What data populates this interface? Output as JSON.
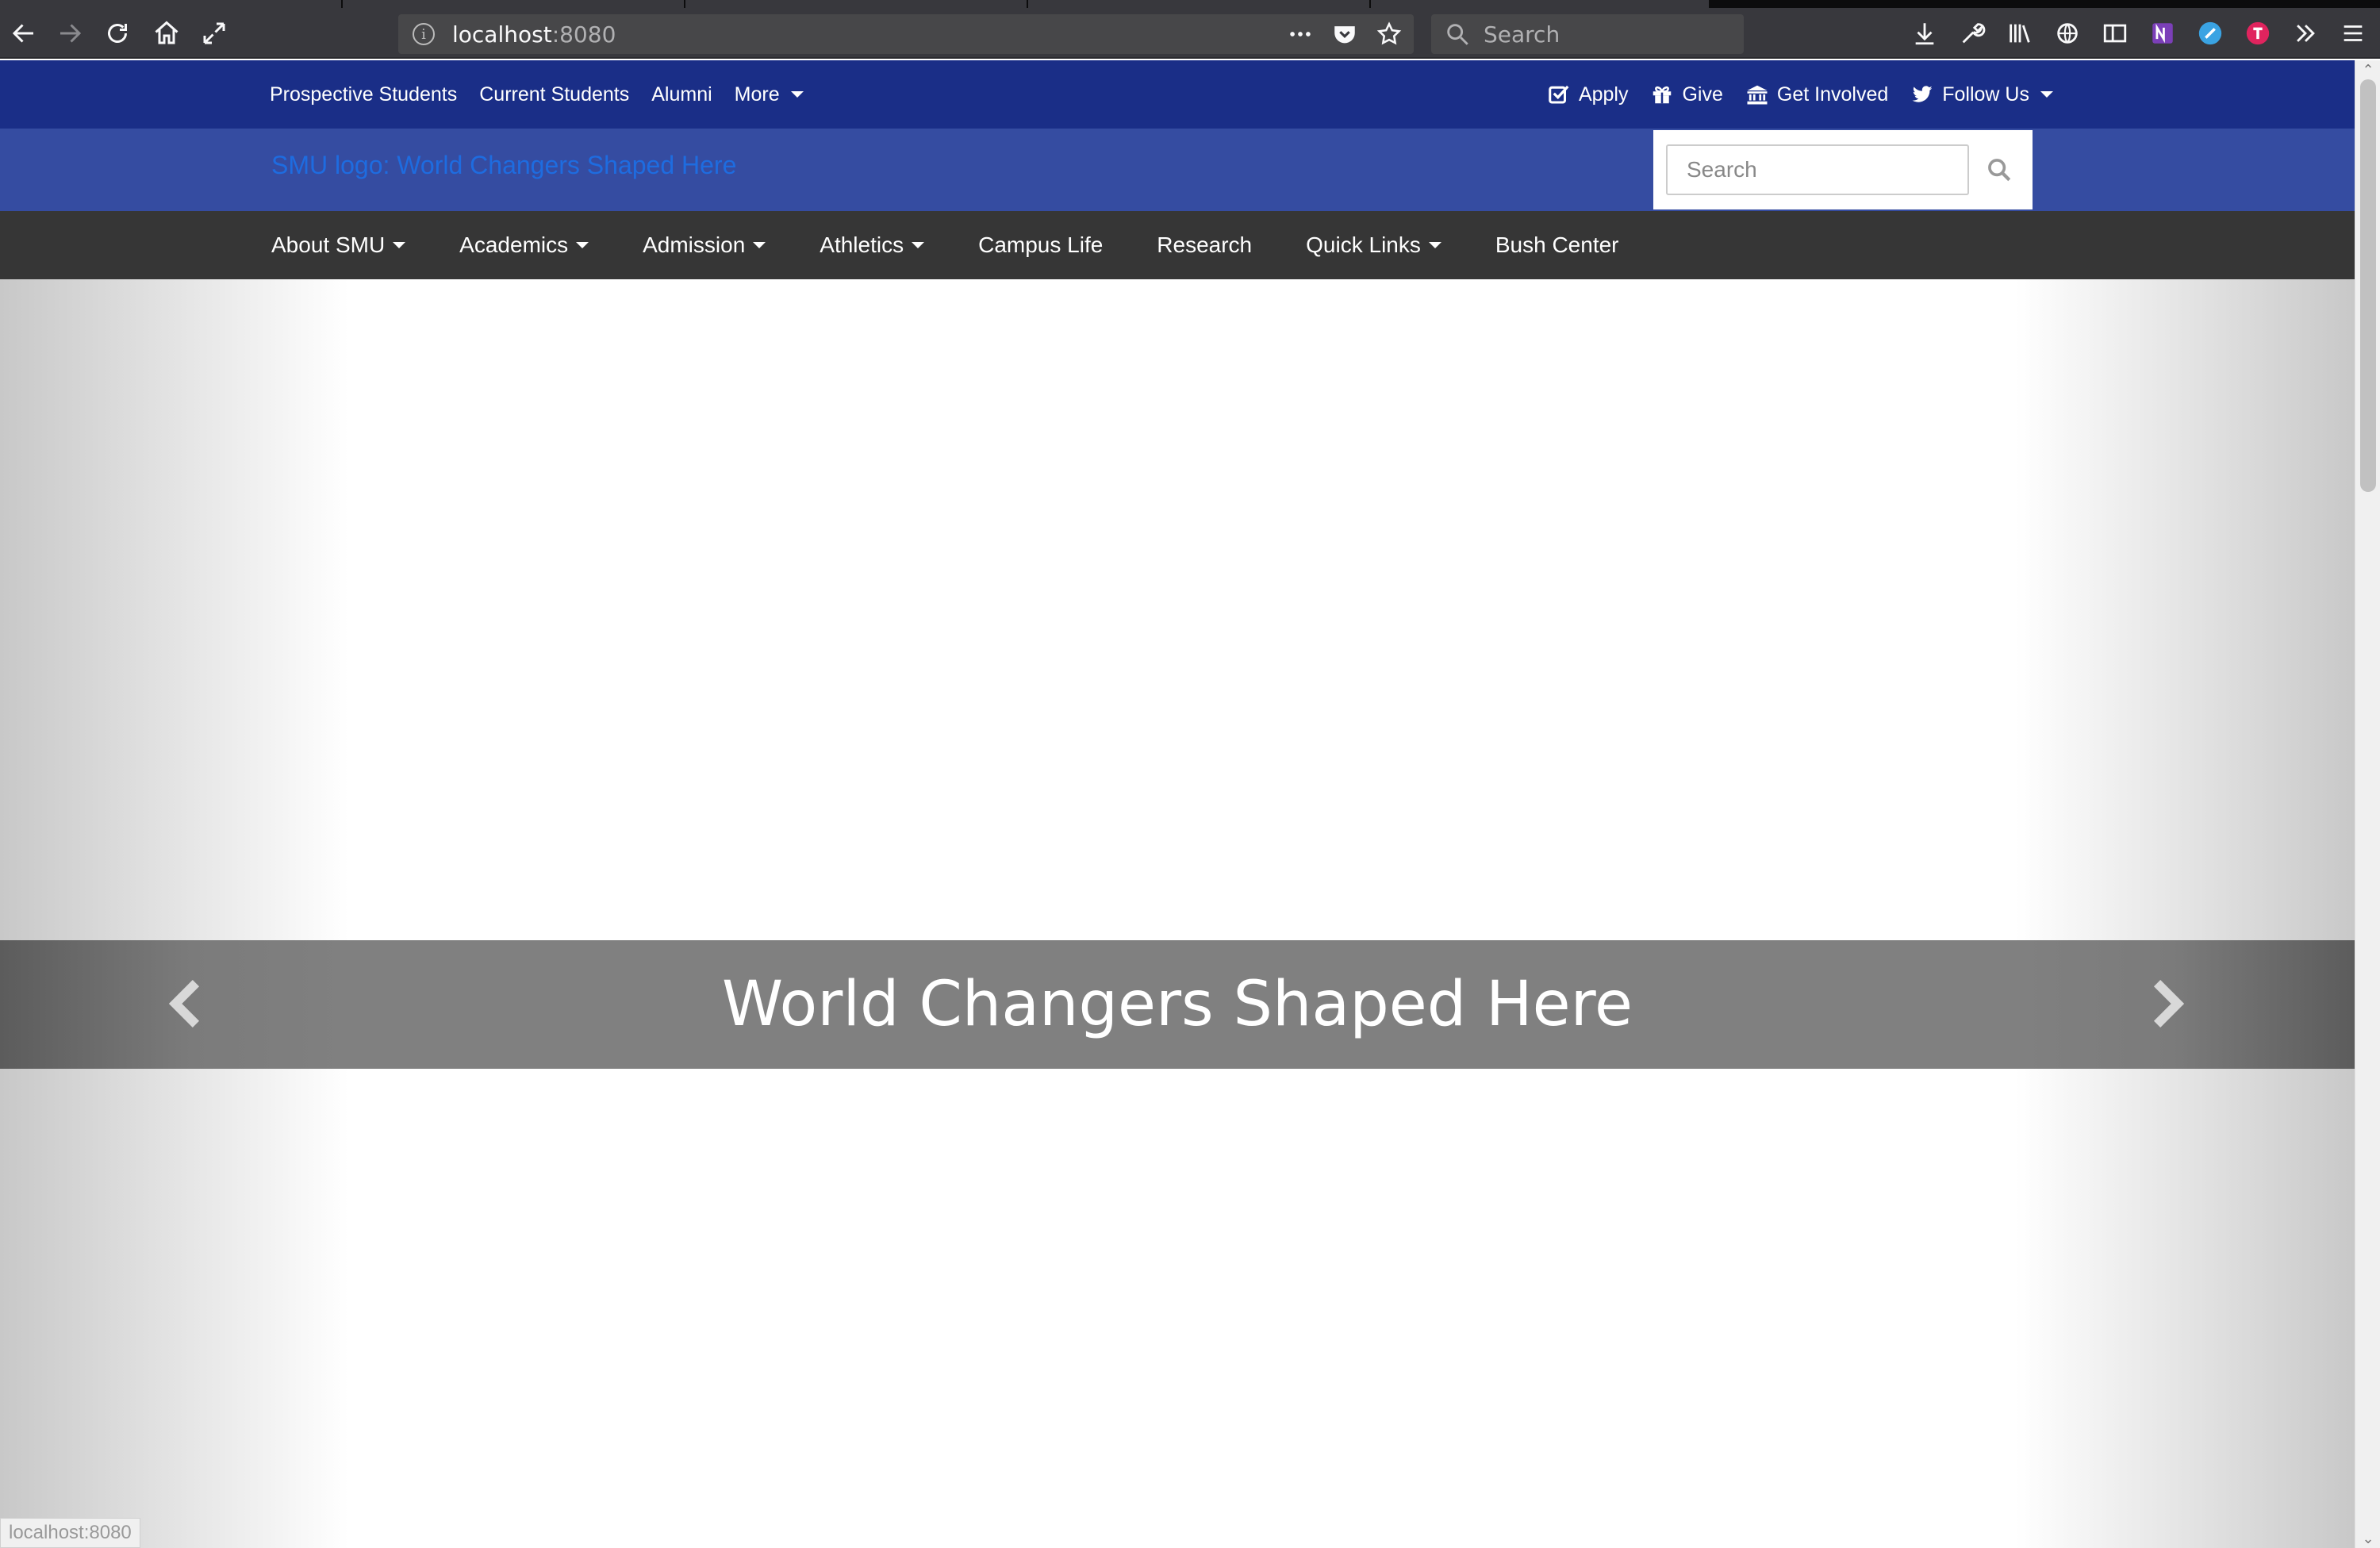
{
  "browser": {
    "url_host": "localhost",
    "url_port": ":8080",
    "search_placeholder": "Search",
    "status_text": "localhost:8080"
  },
  "utility_nav": {
    "left_items": [
      "Prospective Students",
      "Current Students",
      "Alumni",
      "More"
    ],
    "right_items": [
      {
        "label": "Apply",
        "icon": "check-square-icon"
      },
      {
        "label": "Give",
        "icon": "gift-icon"
      },
      {
        "label": "Get Involved",
        "icon": "institution-icon"
      },
      {
        "label": "Follow Us",
        "icon": "twitter-icon"
      }
    ]
  },
  "brand": {
    "logo_alt_text": "SMU logo: World Changers Shaped Here",
    "search_placeholder": "Search"
  },
  "main_nav": {
    "items": [
      "About SMU",
      "Academics",
      "Admission",
      "Athletics",
      "Campus Life",
      "Research",
      "Quick Links",
      "Bush Center"
    ]
  },
  "hero": {
    "caption": "World Changers Shaped Here"
  },
  "colors": {
    "utility_nav_bg": "#1a2e87",
    "brand_bar_bg": "#354ca1",
    "main_nav_bg": "#363636",
    "logo_link": "#1e6ce0"
  }
}
